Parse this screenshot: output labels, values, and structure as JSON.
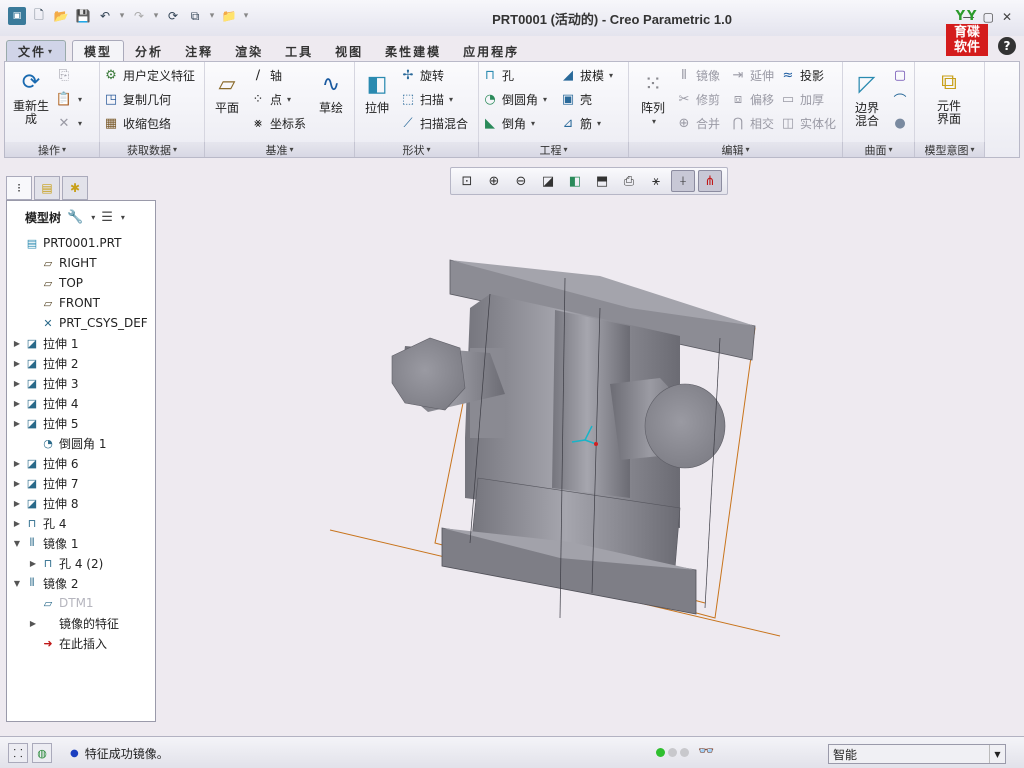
{
  "window": {
    "title": "PRT0001 (活动的) - Creo Parametric 1.0"
  },
  "logo": {
    "top": "YY",
    "bottom": "育碟\n软件"
  },
  "quick_access": [
    "new-icon",
    "open-icon",
    "save-icon",
    "undo-icon",
    "redo-icon",
    "regenerate-icon",
    "switch-window-icon",
    "close-icon",
    "customize-icon"
  ],
  "tabs": [
    {
      "label": "文件",
      "file": true
    },
    {
      "label": "模型",
      "active": true
    },
    {
      "label": "分析"
    },
    {
      "label": "注释"
    },
    {
      "label": "渲染"
    },
    {
      "label": "工具"
    },
    {
      "label": "视图"
    },
    {
      "label": "柔性建模"
    },
    {
      "label": "应用程序"
    }
  ],
  "ribbon": {
    "groups": {
      "operations": "操作",
      "get_data": "获取数据",
      "datum": "基准",
      "shapes": "形状",
      "engineering": "工程",
      "editing": "编辑",
      "surfaces": "曲面",
      "model_intent": "模型意图"
    },
    "buttons": {
      "regenerate": "重新生成",
      "user_defined_feature": "用户定义特征",
      "copy_geometry": "复制几何",
      "shrinkwrap": "收缩包络",
      "plane": "平面",
      "axis": "轴",
      "point": "点",
      "csys": "坐标系",
      "sketch": "草绘",
      "extrude": "拉伸",
      "revolve": "旋转",
      "sweep": "扫描",
      "swept_blend": "扫描混合",
      "hole": "孔",
      "round": "倒圆角",
      "chamfer": "倒角",
      "draft": "拔模",
      "shell": "壳",
      "rib": "筋",
      "pattern": "阵列",
      "mirror": "镜像",
      "trim": "修剪",
      "merge": "合并",
      "extend": "延伸",
      "offset": "偏移",
      "intersect": "相交",
      "project": "投影",
      "thicken": "加厚",
      "solidify": "实体化",
      "boundary_blend": "边界混合",
      "component_interface": "元件界面"
    }
  },
  "navigator": {
    "header": "模型树",
    "tree": [
      {
        "label": "PRT0001.PRT",
        "icon": "part",
        "expand": "",
        "indent": 0
      },
      {
        "label": "RIGHT",
        "icon": "datum-plane",
        "expand": "",
        "indent": 1
      },
      {
        "label": "TOP",
        "icon": "datum-plane",
        "expand": "",
        "indent": 1
      },
      {
        "label": "FRONT",
        "icon": "datum-plane",
        "expand": "",
        "indent": 1
      },
      {
        "label": "PRT_CSYS_DEF",
        "icon": "csys",
        "expand": "",
        "indent": 1
      },
      {
        "label": "拉伸 1",
        "icon": "extrude",
        "expand": "right",
        "indent": 0
      },
      {
        "label": "拉伸 2",
        "icon": "extrude",
        "expand": "right",
        "indent": 0
      },
      {
        "label": "拉伸 3",
        "icon": "extrude",
        "expand": "right",
        "indent": 0
      },
      {
        "label": "拉伸 4",
        "icon": "extrude",
        "expand": "right",
        "indent": 0
      },
      {
        "label": "拉伸 5",
        "icon": "extrude",
        "expand": "right",
        "indent": 0
      },
      {
        "label": "倒圆角 1",
        "icon": "round",
        "expand": "",
        "indent": 1
      },
      {
        "label": "拉伸 6",
        "icon": "extrude",
        "expand": "right",
        "indent": 0
      },
      {
        "label": "拉伸 7",
        "icon": "extrude",
        "expand": "right",
        "indent": 0
      },
      {
        "label": "拉伸 8",
        "icon": "extrude",
        "expand": "right",
        "indent": 0
      },
      {
        "label": "孔 4",
        "icon": "hole",
        "expand": "right",
        "indent": 0
      },
      {
        "label": "镜像 1",
        "icon": "mirror",
        "expand": "down",
        "indent": 0
      },
      {
        "label": "孔 4 (2)",
        "icon": "hole",
        "expand": "right",
        "indent": 1
      },
      {
        "label": "镜像 2",
        "icon": "mirror",
        "expand": "down",
        "indent": 0
      },
      {
        "label": "DTM1",
        "icon": "datum-plane-disabled",
        "expand": "",
        "indent": 1,
        "disabled": true
      },
      {
        "label": "镜像的特征",
        "icon": "",
        "expand": "right",
        "indent": 1
      },
      {
        "label": "在此插入",
        "icon": "insert",
        "expand": "",
        "indent": 1,
        "insert": true
      }
    ]
  },
  "graphics_toolbar": [
    "refit-icon",
    "zoom-in-icon",
    "zoom-out-icon",
    "repaint-icon",
    "display-style-icon",
    "saved-orientations-icon",
    "view-manager-icon",
    "datum-display-icon",
    "spin-center-icon",
    "annotation-display-icon"
  ],
  "statusbar": {
    "message": "特征成功镜像。",
    "filter": "智能"
  },
  "colors": {
    "ribbon_bg": "#f4f4f8",
    "model_gray": "#8e8e96",
    "datum_orange": "#c8741c",
    "csys_cyan": "#18b4c8"
  }
}
